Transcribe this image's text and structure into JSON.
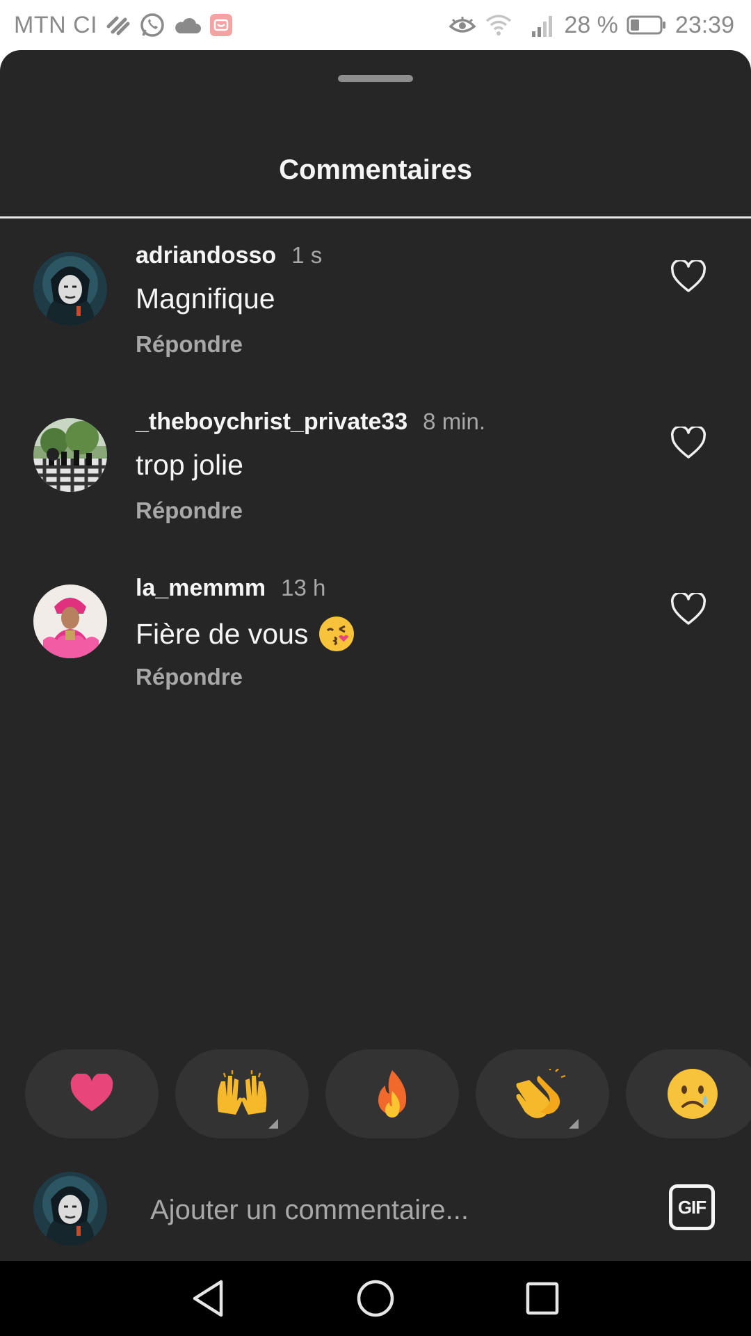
{
  "status_bar": {
    "carrier": "MTN CI",
    "battery_percent": "28 %",
    "time": "23:39",
    "icons": [
      "vibe-icon",
      "whatsapp-icon",
      "cloud-icon",
      "app-badge-icon",
      "eye-icon",
      "wifi-icon",
      "signal-icon",
      "battery-icon"
    ]
  },
  "sheet": {
    "title": "Commentaires"
  },
  "comments": [
    {
      "username": "adriandosso",
      "time": "1 s",
      "text": "Magnifique",
      "reply_label": "Répondre"
    },
    {
      "username": "_theboychrist_private33",
      "time": "8 min.",
      "text": "trop jolie",
      "reply_label": "Répondre"
    },
    {
      "username": "la_memmm",
      "time": "13 h",
      "text": "Fière de vous",
      "emoji": "kissing-face-emoji",
      "reply_label": "Répondre"
    }
  ],
  "reactions": [
    {
      "name": "heart",
      "emoji": "❤",
      "has_variants": false
    },
    {
      "name": "raising-hands",
      "emoji": "🙌",
      "has_variants": true
    },
    {
      "name": "fire",
      "emoji": "🔥",
      "has_variants": false
    },
    {
      "name": "clapping-hands",
      "emoji": "👏",
      "has_variants": true
    },
    {
      "name": "sad-face",
      "emoji": "😢",
      "has_variants": false
    }
  ],
  "compose": {
    "placeholder": "Ajouter un commentaire...",
    "gif_label": "GIF"
  },
  "colors": {
    "sheet_background": "#262626",
    "reaction_pill": "#333333",
    "primary_text": "#f5f5f5",
    "secondary_text": "#a8a8a8",
    "heart": "#e8457a"
  }
}
